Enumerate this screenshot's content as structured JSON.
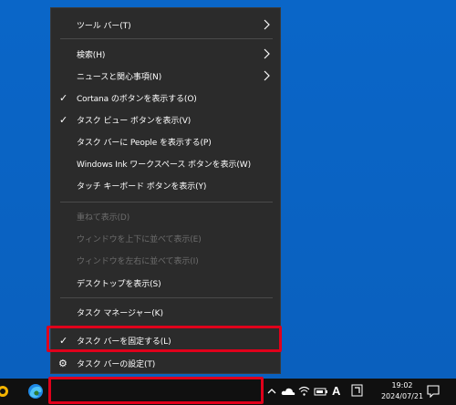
{
  "menu": {
    "items": [
      {
        "label": "ツール バー(T)",
        "submenu": true
      },
      {
        "label": "検索(H)",
        "submenu": true
      },
      {
        "label": "ニュースと関心事項(N)",
        "submenu": true
      },
      {
        "label": "Cortana のボタンを表示する(O)",
        "checked": true
      },
      {
        "label": "タスク ビュー ボタンを表示(V)",
        "checked": true
      },
      {
        "label": "タスク バーに People を表示する(P)"
      },
      {
        "label": "Windows Ink ワークスペース ボタンを表示(W)"
      },
      {
        "label": "タッチ キーボード ボタンを表示(Y)"
      },
      {
        "label": "重ねて表示(D)",
        "disabled": true
      },
      {
        "label": "ウィンドウを上下に並べて表示(E)",
        "disabled": true
      },
      {
        "label": "ウィンドウを左右に並べて表示(I)",
        "disabled": true
      },
      {
        "label": "デスクトップを表示(S)"
      },
      {
        "label": "タスク マネージャー(K)"
      },
      {
        "label": "タスク バーを固定する(L)",
        "checked": true
      },
      {
        "label": "タスク バーの設定(T)",
        "icon": "gear-icon"
      }
    ]
  },
  "taskbar": {
    "clock_time": "19:02",
    "clock_date": "2024/07/21",
    "ime_indicator": "A"
  },
  "colors": {
    "desktop": "#0a63c4",
    "menu_bg": "#2b2b2b",
    "highlight": "#e0001b",
    "taskbar": "#101010"
  }
}
